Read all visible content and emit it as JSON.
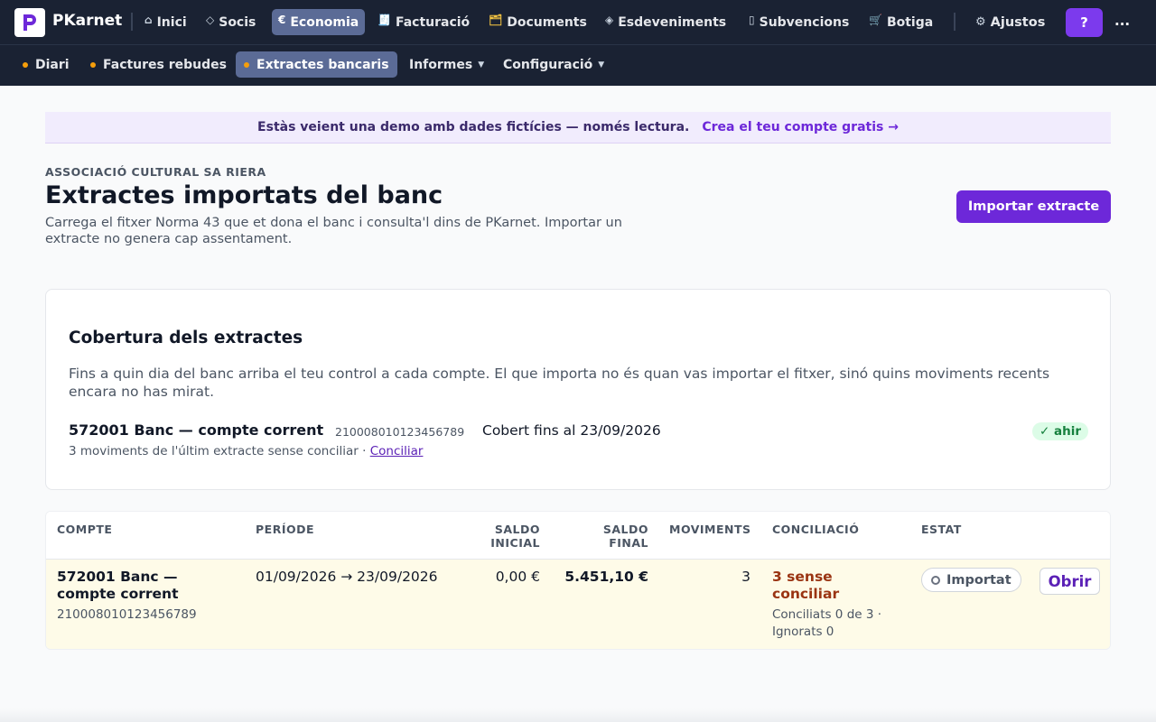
{
  "app": {
    "name": "PKarnet"
  },
  "nav": {
    "items": [
      {
        "icon": "home-icon",
        "glyph": "⌂",
        "label": "Inici"
      },
      {
        "icon": "diamond-icon",
        "glyph": "◇",
        "label": "Socis"
      },
      {
        "icon": "euro-icon",
        "glyph": "€",
        "label": "Economia"
      },
      {
        "icon": "receipt-icon",
        "glyph": "🧾",
        "label": "Facturació"
      },
      {
        "icon": "folder-icon",
        "glyph": "🗂",
        "label": "Documents"
      },
      {
        "icon": "event-icon",
        "glyph": "◈",
        "label": "Esdeveniments"
      },
      {
        "icon": "book-icon",
        "glyph": "▯",
        "label": "Subvencions"
      },
      {
        "icon": "cart-icon",
        "glyph": "🛒",
        "label": "Botiga"
      }
    ],
    "settings": {
      "glyph": "⚙",
      "label": "Ajustos"
    },
    "help_label": "?",
    "more_label": "..."
  },
  "subnav": {
    "items": [
      {
        "label": "Diari"
      },
      {
        "label": "Factures rebudes"
      },
      {
        "label": "Extractes bancaris"
      },
      {
        "label": "Informes"
      },
      {
        "label": "Configuració"
      }
    ]
  },
  "banner": {
    "text": "Estàs veient una demo amb dades fictícies — només lectura.",
    "link": "Crea el teu compte gratis →"
  },
  "header": {
    "org": "ASSOCIACIÓ CULTURAL SA RIERA",
    "title": "Extractes importats del banc",
    "description": "Carrega el fitxer Norma 43 que et dona el banc i consulta'l dins de PKarnet. Importar un extracte no genera cap assentament.",
    "import_button": "Importar extracte"
  },
  "coverage": {
    "title": "Cobertura dels extractes",
    "description": "Fins a quin dia del banc arriba el teu control a cada compte. El que importa no és quan vas importar el fitxer, sinó quins moviments recents encara no has mirat.",
    "account_name": "572001 Banc — compte corrent",
    "account_iban": "210008010123456789",
    "covered": "Cobert fins al 23/09/2026",
    "note": "3 moviments de l'últim extracte sense conciliar · ",
    "note_link": "Conciliar",
    "badge": "✓ ahir"
  },
  "table": {
    "headers": {
      "compte": "COMPTE",
      "periode": "PERÍODE",
      "saldo_inicial_1": "SALDO",
      "saldo_inicial_2": "INICIAL",
      "saldo_final_1": "SALDO",
      "saldo_final_2": "FINAL",
      "moviments": "MOVIMENTS",
      "conciliacio": "CONCILIACIÓ",
      "estat": "ESTAT"
    },
    "row": {
      "compte_1": "572001 Banc —",
      "compte_2": "compte corrent",
      "iban": "210008010123456789",
      "periode": "01/09/2026 → 23/09/2026",
      "saldo_inicial": "0,00 €",
      "saldo_final": "5.451,10 €",
      "moviments": "3",
      "concil_1": "3 sense",
      "concil_2": "conciliar",
      "concil_sub_1": "Conciliats 0 de 3 ·",
      "concil_sub_2": "Ignorats 0",
      "estat": "Importat",
      "open": "Obrir"
    }
  }
}
